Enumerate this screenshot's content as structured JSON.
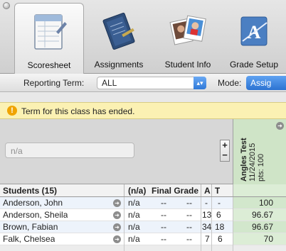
{
  "tabs": [
    {
      "label": "Scoresheet",
      "icon": "scoresheet-icon",
      "selected": true
    },
    {
      "label": "Assignments",
      "icon": "assignments-icon",
      "selected": false
    },
    {
      "label": "Student Info",
      "icon": "student-info-icon",
      "selected": false
    },
    {
      "label": "Grade Setup",
      "icon": "grade-setup-icon",
      "selected": false
    }
  ],
  "toolbar": {
    "reporting_term_label": "Reporting Term:",
    "reporting_term_value": "ALL",
    "mode_label": "Mode:",
    "mode_value": "Assig"
  },
  "notice": {
    "text": "Term for this class has ended."
  },
  "filter": {
    "placeholder": "n/a"
  },
  "assignment": {
    "name": "Angles Test",
    "date": "11/24/2015",
    "points": "pts: 100"
  },
  "table": {
    "headers": {
      "students": "Students (15)",
      "na": "(n/a)",
      "final_grade": "Final Grade",
      "a": "A",
      "t": "T"
    },
    "rows": [
      {
        "name": "Anderson, John",
        "na": "n/a",
        "f1": "--",
        "f2": "--",
        "a": "-",
        "t": "-",
        "score": "100"
      },
      {
        "name": "Anderson, Sheila",
        "na": "n/a",
        "f1": "--",
        "f2": "--",
        "a": "13",
        "t": "6",
        "score": "96.67"
      },
      {
        "name": "Brown, Fabian",
        "na": "n/a",
        "f1": "--",
        "f2": "--",
        "a": "34",
        "t": "18",
        "score": "96.67"
      },
      {
        "name": "Falk, Chelsea",
        "na": "n/a",
        "f1": "--",
        "f2": "--",
        "a": "7",
        "t": "6",
        "score": "70"
      }
    ]
  },
  "colors": {
    "accent": "#2f79d8",
    "notice": "#fbf1b3",
    "assignment_col": "#cfe4c7"
  }
}
